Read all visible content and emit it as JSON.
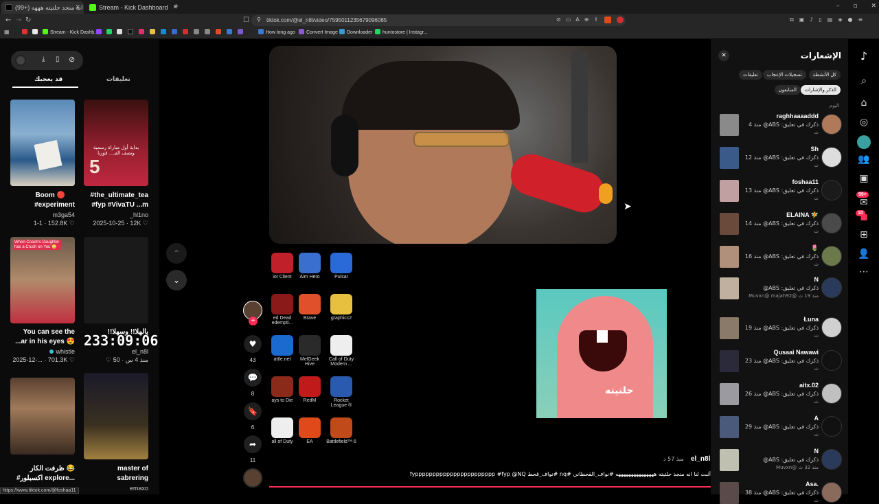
{
  "browser": {
    "tabs": [
      {
        "label": "(99+) أثبت لنا انه منجد حلتيته هههه"
      },
      {
        "label": "Stream - Kick Dashboard"
      }
    ],
    "new_tab": "+",
    "url": "tiktok.com/@el_n8l/video/7595011235679096085",
    "bookmarks": [
      {
        "label": "Stream - Kick Dashb..."
      },
      {
        "label": "How long ago"
      },
      {
        "label": "Convert Image"
      },
      {
        "label": "Downloader"
      },
      {
        "label": "huntostore | Instagr..."
      }
    ],
    "status_url": "https://www.tiktok.com/@foshaa11"
  },
  "left": {
    "tabs": [
      "تعليقات",
      "قد يعجبك"
    ],
    "cards": [
      {
        "title": "Boom 🔴",
        "title2": "#experiment",
        "author": "m3ga54",
        "stats": "1-1 · 152.8K ♡"
      },
      {
        "title": "#the_ultimate_tea",
        "title2": "#fyp #VivaTU ...m",
        "author": "_hl1no",
        "stats": "2025-10-25 · 12K ♡"
      },
      {
        "title": "You can see the",
        "title2": "...ar in his eyes 😍",
        "author": "whistle",
        "stats": "2025-12-... · 701.3K ♡"
      },
      {
        "title": "يالهلا!! وسهلا!!",
        "title2": "",
        "author": "el_n8l",
        "stats": "منذ 4 س · 50 ♡"
      },
      {
        "title": "😂 ظرفت الكار",
        "title2": "#اكسبلور explore...",
        "author": "",
        "stats": ""
      },
      {
        "title": "master of",
        "title2": "sabrering",
        "author": "emaxo",
        "stats": ""
      }
    ],
    "timer": "233:09:06",
    "card_caption_1": "When Coach's Daughter has a Crush on You 😳",
    "card_caption_2": "بداية أول مباراة رسمية ونصف الفـ... فوزنا"
  },
  "player": {
    "likes": "43",
    "comments": "8",
    "saves": "6",
    "shares": "11",
    "sticker_text": "حلتيته",
    "author": "el_n8l",
    "time": "منذ 57 د",
    "caption": "أثبت لنا انه منجد حلتيته هههههههههههههههه #نواف_القحطاني #nq #نواف_قحط fyppppppppppppppppppppppp #fyp @NQ"
  },
  "desktop_icons": [
    {
      "label": "iot Client",
      "color": "#c0202a"
    },
    {
      "label": "Aim Hero",
      "color": "#3a6fd0"
    },
    {
      "label": "Pulsar",
      "color": "#2a6ad8"
    },
    {
      "label": "ed Dead\nedempti...",
      "color": "#8a1a1a"
    },
    {
      "label": "Brave",
      "color": "#e0502a"
    },
    {
      "label": "graphicc2",
      "color": "#e8c040"
    },
    {
      "label": "attle.net",
      "color": "#1a6ad0"
    },
    {
      "label": "MelGeek\nHive",
      "color": "#2a2a2a"
    },
    {
      "label": "Call of Duty\nModern ...",
      "color": "#eeeeee"
    },
    {
      "label": "ays to Die",
      "color": "#8a2a1a"
    },
    {
      "label": "RedM",
      "color": "#c01a1a"
    },
    {
      "label": "Rocket\nLeague ®",
      "color": "#2a5ab0"
    },
    {
      "label": "all of Duty",
      "color": "#eeeeee"
    },
    {
      "label": "EA",
      "color": "#e04a1a"
    },
    {
      "label": "Battlefield™ 6",
      "color": "#c04a1a"
    }
  ],
  "notifications": {
    "title": "الإشعارات",
    "filters": [
      "كل الأنشطة",
      "تسجيلات الإعجاب",
      "تعليقات",
      "الذكر والإشارات",
      "المتابعون"
    ],
    "today": "اليوم",
    "items": [
      {
        "name": "raghhaaaaddd",
        "text": "ذكرك في تعليق: ABS@ منذ 4",
        "sub": "ث"
      },
      {
        "name": "Sh",
        "text": "ذكرك في تعليق: ABS@ منذ 12",
        "sub": "ث"
      },
      {
        "name": "foshaa11",
        "text": "ذكرك في تعليق: ABS@ منذ 13",
        "sub": "ث"
      },
      {
        "name": "ELAINA 🧚",
        "text": "ذكرك في تعليق: ABS@ منذ 14",
        "sub": "ث"
      },
      {
        "name": "🌷",
        "text": "ذكرك في تعليق: ABS@ منذ 16",
        "sub": "ث"
      },
      {
        "name": "N",
        "text": "ذكرك في تعليق: ABS@",
        "sub": "Muvxn@ majah92@ منذ 19 ث"
      },
      {
        "name": "Łuna",
        "text": "ذكرك في تعليق: ABS@ منذ 19",
        "sub": "ث"
      },
      {
        "name": "Qusaai Nawawi",
        "text": "ذكرك في تعليق: ABS@ منذ 23",
        "sub": "ث"
      },
      {
        "name": "aitx.02",
        "text": "ذكرك في تعليق: ABS@ منذ 26",
        "sub": "ث"
      },
      {
        "name": "A",
        "text": "ذكرك في تعليق: ABS@ منذ 29",
        "sub": "ث"
      },
      {
        "name": "N",
        "text": "ذكرك في تعليق: ABS@",
        "sub": "Muvxn@ منذ 32 ث"
      },
      {
        "name": "Asa.",
        "text": "ذكرك في تعليق: ABS@ منذ 38",
        "sub": "ث"
      }
    ]
  },
  "rightnav": {
    "badge_inbox": "99+",
    "badge_activity": "10"
  },
  "colors": {
    "accent": "#fe2c55",
    "panel": "#121212"
  }
}
